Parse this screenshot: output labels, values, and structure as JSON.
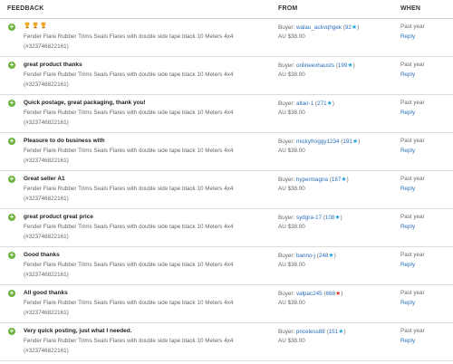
{
  "header": {
    "feedback": "FEEDBACK",
    "from": "FROM",
    "when": "WHEN"
  },
  "rows": [
    {
      "comment": "",
      "item": "Fender Flare Rubber Trims Seals Flares with double side tape black 10 Meters 4x4",
      "item_number": "(#323746822161)",
      "buyer_prefix": "Buyer:",
      "buyer_name": "walau_ackvqhgek",
      "score": "92",
      "price": "AU $38.00",
      "when": "Past year",
      "reply": "Reply"
    },
    {
      "comment": "great product thanks",
      "item": "Fender Flare Rubber Trims Seals Flares with double side tape black 10 Meters 4x4",
      "item_number": "(#323746822161)",
      "buyer_prefix": "Buyer:",
      "buyer_name": "onlineexhausts",
      "score": "199",
      "price": "AU $38.00",
      "when": "Past year",
      "reply": "Reply"
    },
    {
      "comment": "Quick postage, great packaging, thank you!",
      "item": "Fender Flare Rubber Trims Seals Flares with double side tape black 10 Meters 4x4",
      "item_number": "(#323746822161)",
      "buyer_prefix": "Buyer:",
      "buyer_name": "altair-1",
      "score": "271",
      "price": "AU $38.00",
      "when": "Past year",
      "reply": "Reply"
    },
    {
      "comment": "Pleasure to do business with",
      "item": "Fender Flare Rubber Trims Seals Flares with double side tape black 10 Meters 4x4",
      "item_number": "(#323746822161)",
      "buyer_prefix": "Buyer:",
      "buyer_name": "mickyfroggy1234",
      "score": "191",
      "price": "AU $38.00",
      "when": "Past year",
      "reply": "Reply"
    },
    {
      "comment": "Great seller A1",
      "item": "Fender Flare Rubber Trims Seals Flares with double side tape black 10 Meters 4x4",
      "item_number": "(#323746822161)",
      "buyer_prefix": "Buyer:",
      "buyer_name": "hypermagna",
      "score": "187",
      "price": "AU $38.00",
      "when": "Past year",
      "reply": "Reply"
    },
    {
      "comment": "great product great price",
      "item": "Fender Flare Rubber Trims Seals Flares with double side tape black 10 Meters 4x4",
      "item_number": "(#323746822161)",
      "buyer_prefix": "Buyer:",
      "buyer_name": "sydgra-17",
      "score": "108",
      "price": "AU $38.00",
      "when": "Past year",
      "reply": "Reply"
    },
    {
      "comment": "Good thanks",
      "item": "Fender Flare Rubber Trims Seals Flares with double side tape black 10 Meters 4x4",
      "item_number": "(#323746822161)",
      "buyer_prefix": "Buyer:",
      "buyer_name": "banno-j",
      "score": "248",
      "price": "AU $38.00",
      "when": "Past year",
      "reply": "Reply"
    },
    {
      "comment": "All good thanks",
      "item": "Fender Flare Rubber Trims Seals Flares with double side tape black 10 Meters 4x4",
      "item_number": "(#323746822161)",
      "buyer_prefix": "Buyer:",
      "buyer_name": "valpac245",
      "score": "668",
      "price": "AU $38.00",
      "when": "Past year",
      "reply": "Reply"
    },
    {
      "comment": "Very quick posting, just what I needed.",
      "item": "Fender Flare Rubber Trims Seals Flares with double side tape black 10 Meters 4x4",
      "item_number": "(#323746822161)",
      "buyer_prefix": "Buyer:",
      "buyer_name": "priceless88",
      "score": "151",
      "price": "AU $38.00",
      "when": "Past year",
      "reply": "Reply"
    }
  ],
  "colors": {
    "positive": "#6cb33e",
    "link": "#2a6ebb",
    "star_blue": "#29a3e0",
    "star_red": "#e03a3a"
  },
  "icons": {
    "positive": "plus-circle-icon",
    "star": "star-icon",
    "trophy": "trophy-icon"
  },
  "first_comment_icon": "three-trophy-icons"
}
